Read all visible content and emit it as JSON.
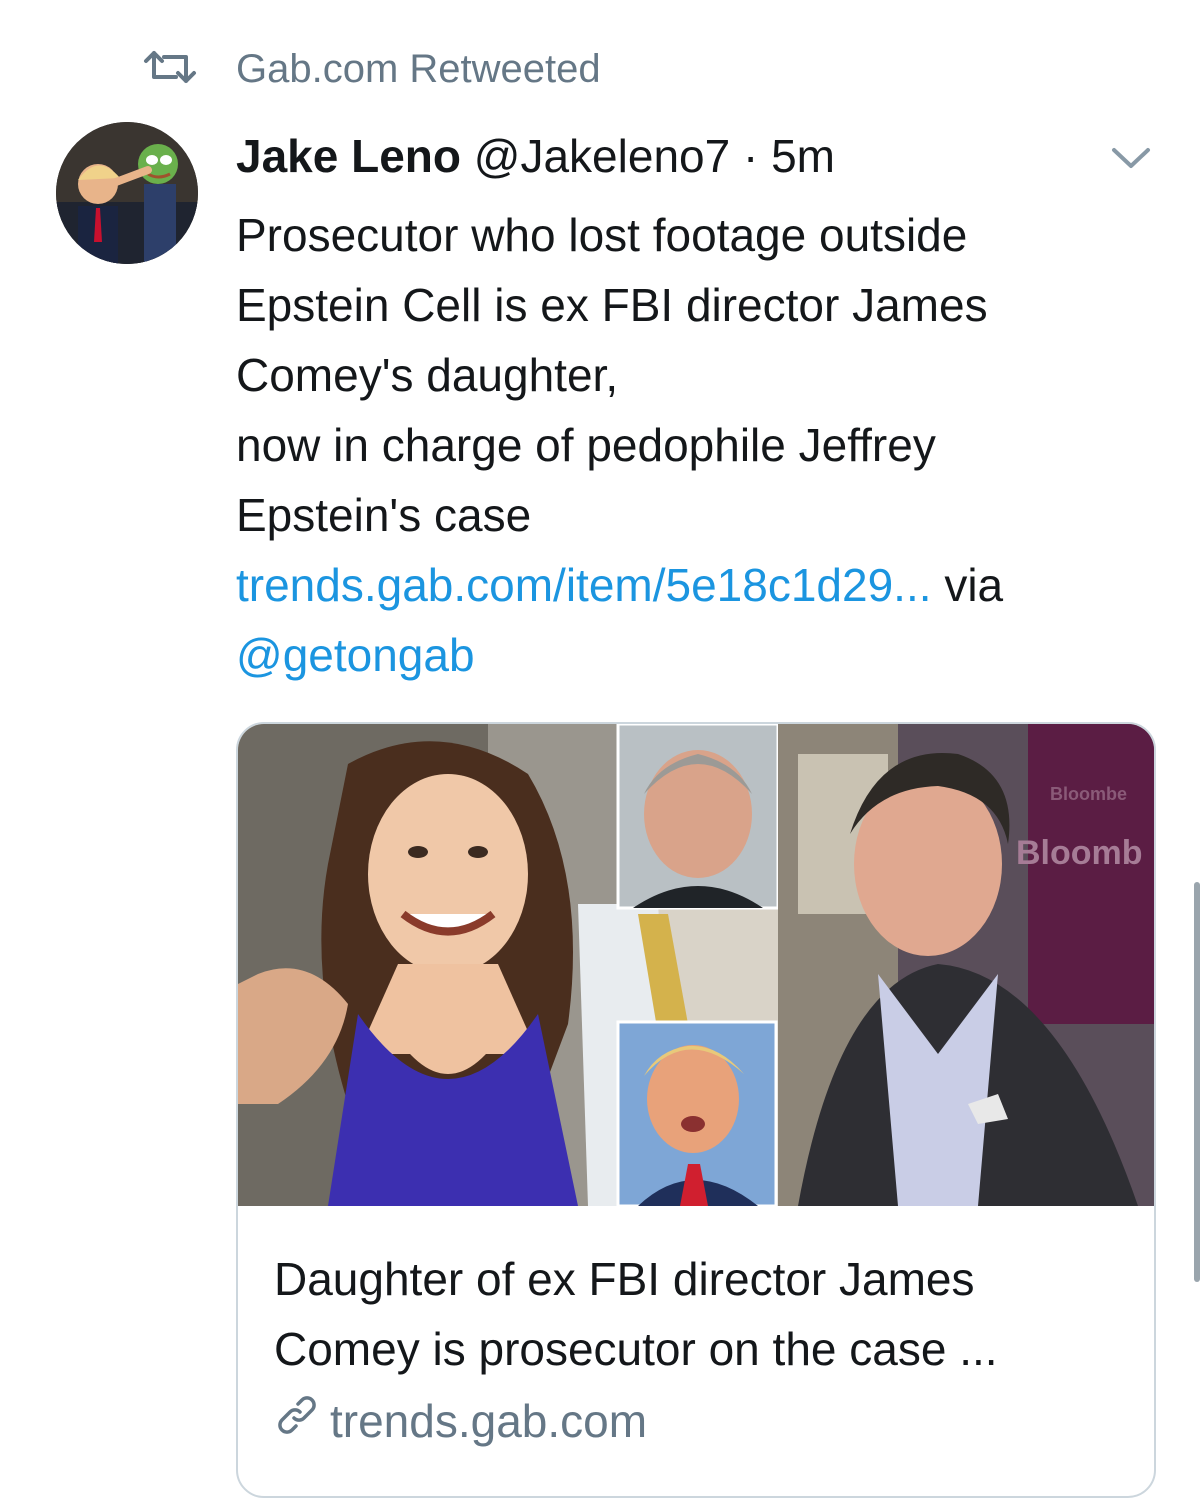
{
  "retweet": {
    "label": "Gab.com Retweeted",
    "icon": "retweet-icon"
  },
  "tweet": {
    "name": "Jake Leno",
    "handle": "@Jakeleno7",
    "separator": "·",
    "time": "5m",
    "menu_icon": "chevron-down-icon",
    "text_lines": [
      "Prosecutor who lost footage outside",
      "Epstein Cell is ex FBI director James",
      "Comey's daughter,",
      "now in charge of pedophile Jeffrey",
      "Epstein's case"
    ],
    "link": "trends.gab.com/item/5e18c1d29...",
    "via": "via",
    "mention": "@getongab"
  },
  "card": {
    "title_lines": [
      "Daughter of ex FBI director James",
      "Comey is prosecutor on the case ..."
    ],
    "domain": "trends.gab.com",
    "image_text": [
      "Bloombe",
      "Bloomb"
    ]
  },
  "colors": {
    "link": "#1b95e0",
    "muted": "#657786",
    "border": "#ccd6dd"
  }
}
